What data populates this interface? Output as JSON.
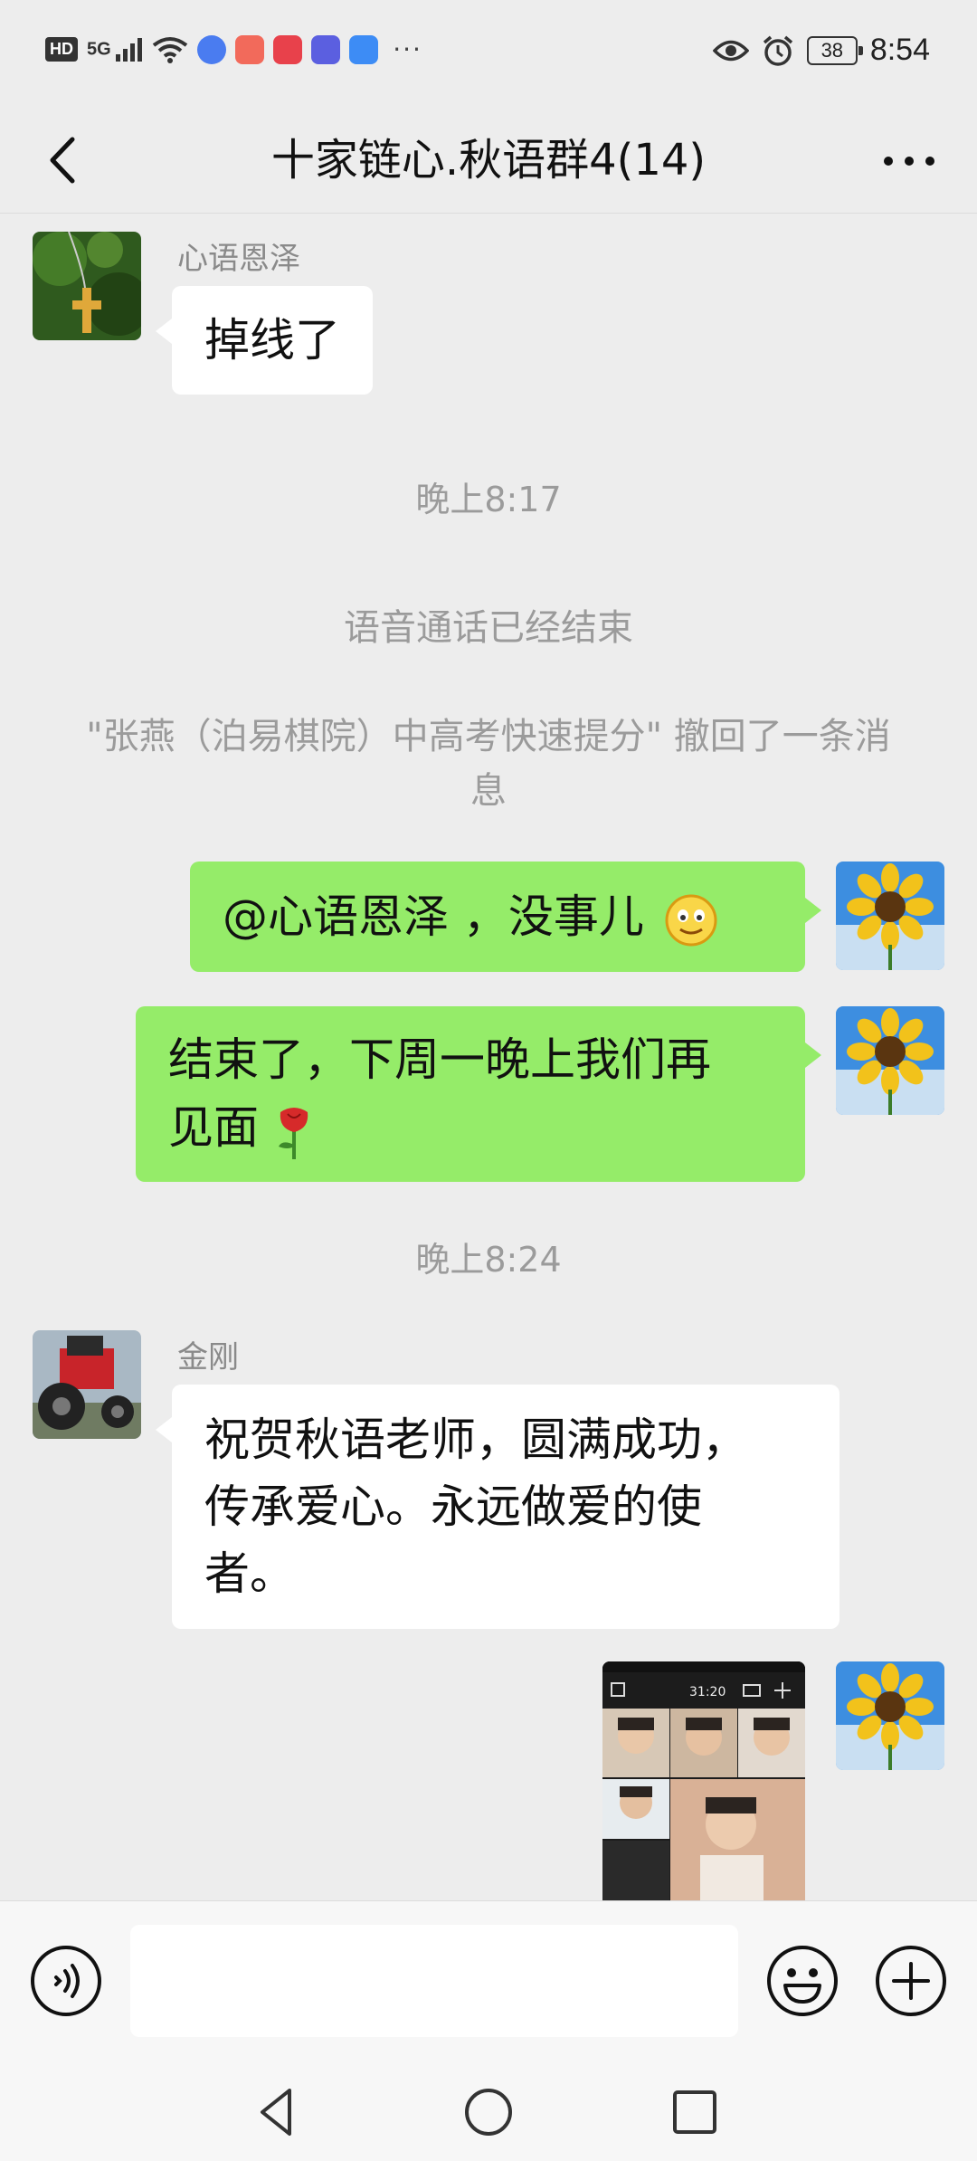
{
  "status_bar": {
    "hd_badge": "HD",
    "signal_label": "5G",
    "more_dots": "···",
    "battery": "38",
    "time": "8:54"
  },
  "nav": {
    "title": "十家链心.秋语群4(14)"
  },
  "messages": {
    "m1": {
      "sender": "心语恩泽",
      "text": "掉线了"
    },
    "ts1": "晚上8:17",
    "sys1": "语音通话已经结束",
    "sys2": "\"张燕（泊易棋院）中高考快速提分\" 撤回了一条消息",
    "m2": {
      "text": "@心语恩泽 ，没事儿"
    },
    "m3": {
      "line1": "结束了，下周一晚上我们再",
      "line2": "见面"
    },
    "ts2": "晚上8:24",
    "m4": {
      "sender": "金刚",
      "line1": "祝贺秋语老师，圆满成功，",
      "line2": "传承爱心。永远做爱的使",
      "line3": "者。"
    },
    "m5": {
      "photo_time": "31:20"
    }
  },
  "colors": {
    "background": "#ededed",
    "bubble_self": "#95ec69",
    "bubble_other": "#ffffff",
    "system_text": "#9b9b9b"
  }
}
